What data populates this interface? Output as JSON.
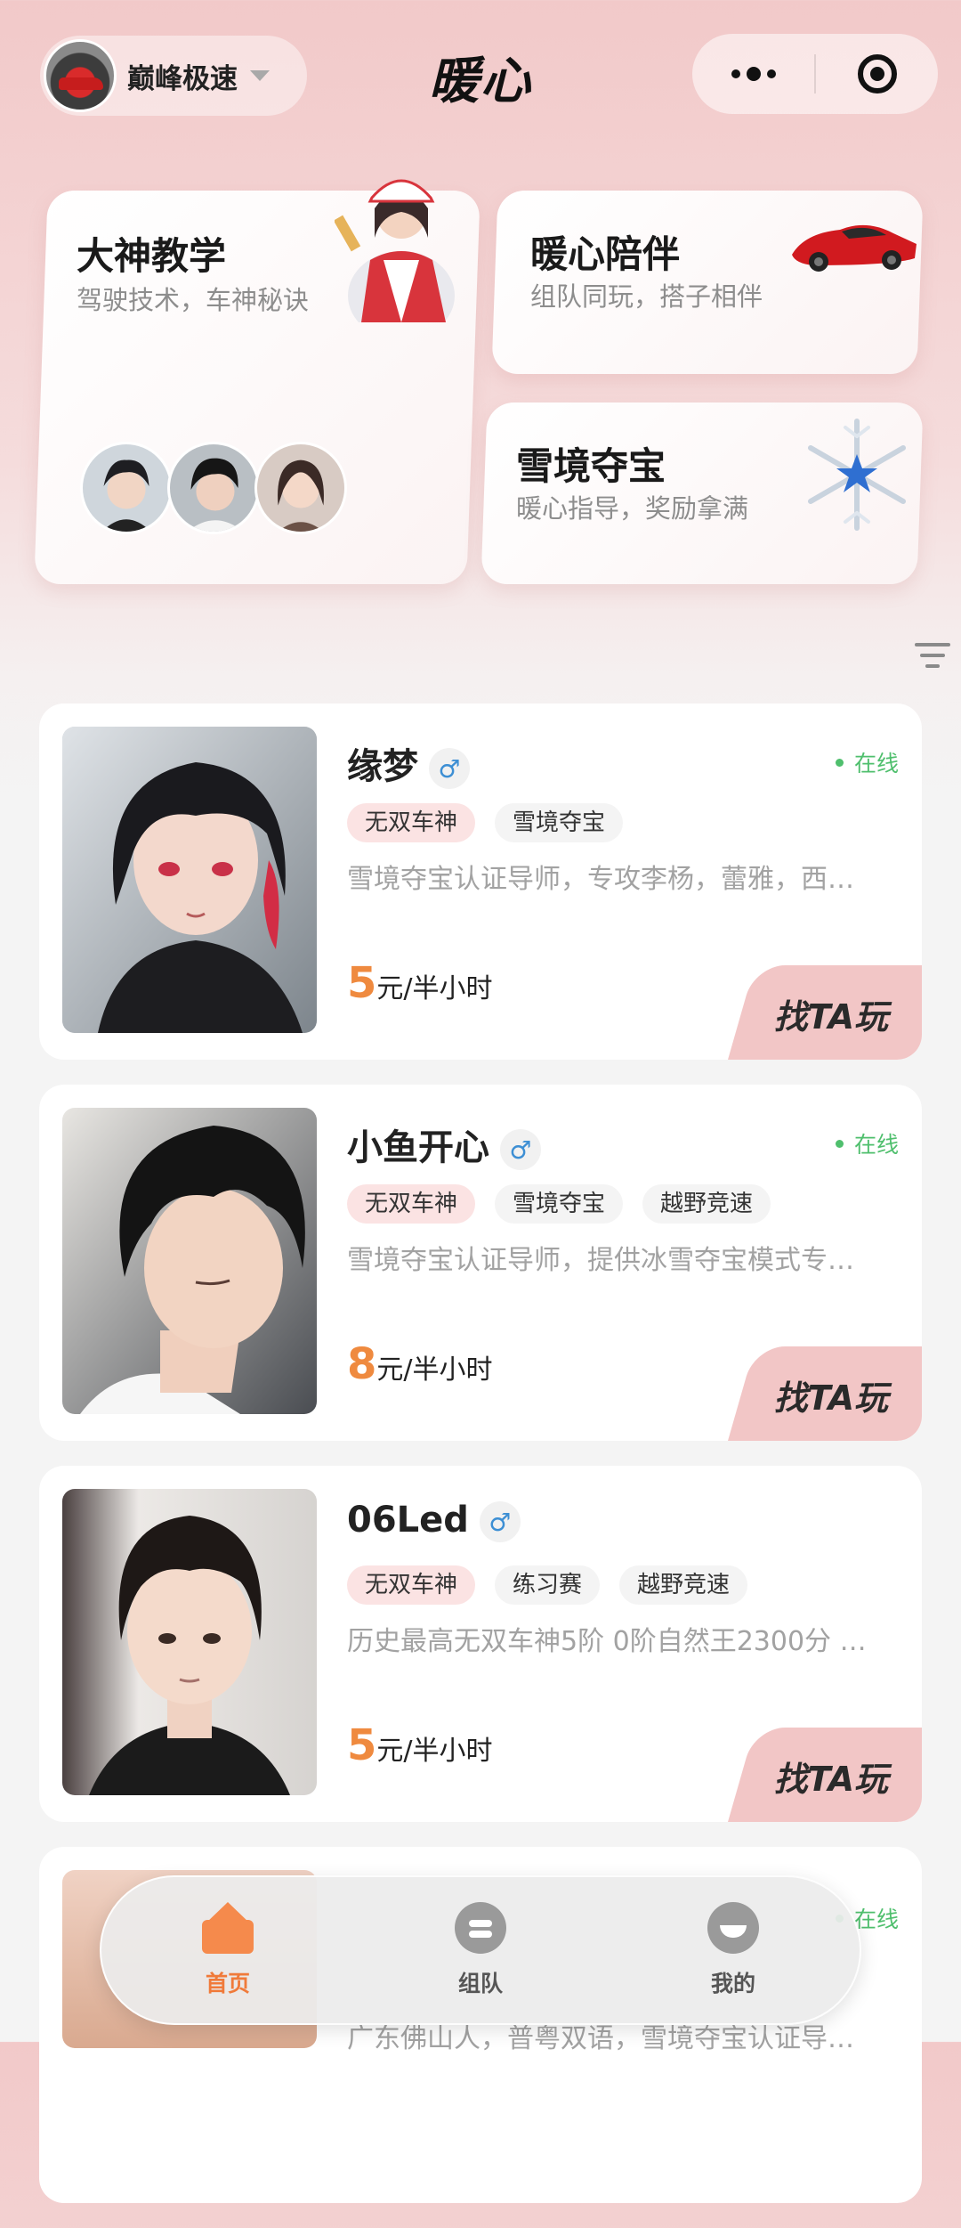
{
  "header": {
    "game_name": "巅峰极速",
    "title": "暖心",
    "more_icon": "more-dots-icon",
    "close_icon": "target-close-icon"
  },
  "features": [
    {
      "title": "大神教学",
      "subtitle": "驾驶技术，车神秘诀"
    },
    {
      "title": "暖心陪伴",
      "subtitle": "组队同玩，搭子相伴"
    },
    {
      "title": "雪境夺宝",
      "subtitle": "暖心指导，奖励拿满"
    }
  ],
  "companions": [
    {
      "name": "缘梦",
      "gender": "♂",
      "status": "在线",
      "tags": [
        "无双车神",
        "雪境夺宝"
      ],
      "desc": "雪境夺宝认证导师，专攻李杨，蕾雅，西…",
      "price_num": "5",
      "price_unit": "元/半小时",
      "cta": "找TA玩"
    },
    {
      "name": "小鱼开心",
      "gender": "♂",
      "status": "在线",
      "tags": [
        "无双车神",
        "雪境夺宝",
        "越野竞速"
      ],
      "desc": "雪境夺宝认证导师，提供冰雪夺宝模式专…",
      "price_num": "8",
      "price_unit": "元/半小时",
      "cta": "找TA玩"
    },
    {
      "name": "06Led",
      "gender": "♂",
      "status": "在线",
      "tags": [
        "无双车神",
        "练习赛",
        "越野竞速"
      ],
      "desc": "历史最高无双车神5阶 0阶自然王2300分 …",
      "price_num": "5",
      "price_unit": "元/半小时",
      "cta": "找TA玩"
    },
    {
      "status": "在线",
      "desc": "广东佛山人，普粤双语，雪境夺宝认证导…"
    }
  ],
  "tabbar": {
    "tabs": [
      {
        "label": "首页",
        "icon": "home-icon",
        "active": true
      },
      {
        "label": "组队",
        "icon": "team-icon",
        "active": false
      },
      {
        "label": "我的",
        "icon": "profile-icon",
        "active": false
      }
    ]
  },
  "colors": {
    "accent": "#f07a3a",
    "price": "#ef8a3f",
    "online": "#4fbf6d",
    "cta_bg": "#f2c6c6",
    "header_bg": "#f2c9c9"
  }
}
